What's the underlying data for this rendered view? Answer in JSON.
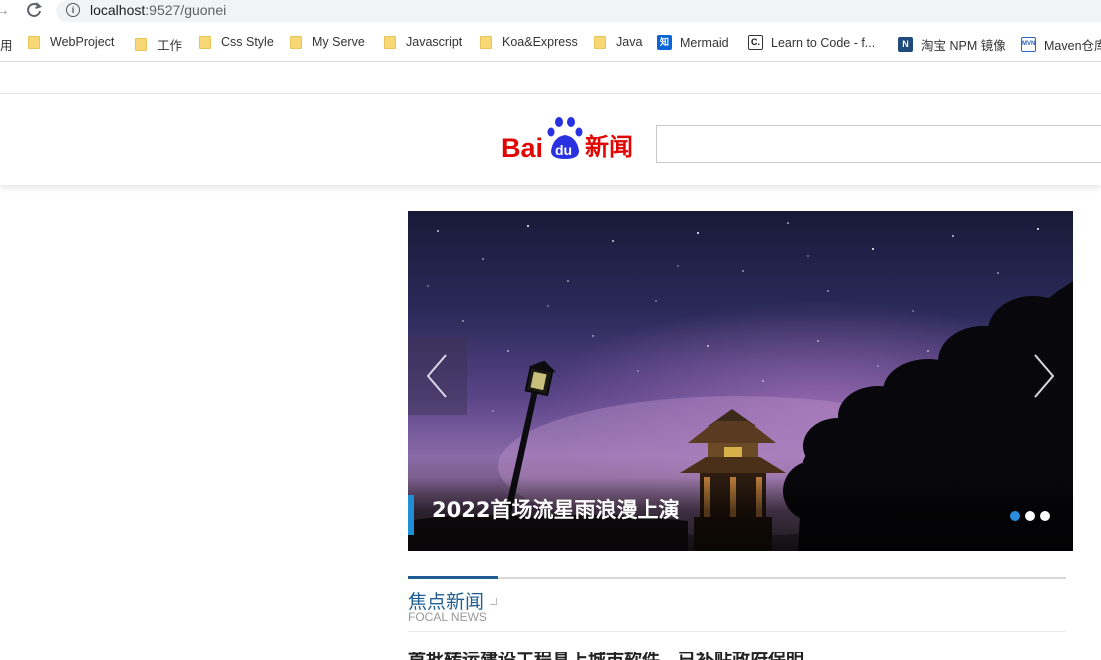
{
  "browser": {
    "url_host": "localhost",
    "url_path": ":9527/guonei",
    "bookmarks": [
      {
        "label": "用",
        "icon": "none"
      },
      {
        "label": "WebProject",
        "icon": "folder-icon"
      },
      {
        "label": "工作",
        "icon": "folder-icon"
      },
      {
        "label": "Css Style",
        "icon": "folder-icon"
      },
      {
        "label": "My Serve",
        "icon": "folder-icon"
      },
      {
        "label": "Javascript",
        "icon": "folder-icon"
      },
      {
        "label": "Koa&Express",
        "icon": "folder-icon"
      },
      {
        "label": "Java",
        "icon": "folder-icon"
      },
      {
        "label": "Mermaid",
        "icon": "zhihu-icon",
        "icon_text": "知",
        "color": "#0a66d6"
      },
      {
        "label": "Learn to Code - f...",
        "icon": "freecodecamp-icon",
        "icon_text": "C.",
        "color": "#ffffff"
      },
      {
        "label": "淘宝 NPM 镜像",
        "icon": "npm-icon",
        "icon_text": "N",
        "color": "#1f4a7a"
      },
      {
        "label": "Maven仓库",
        "icon": "maven-icon",
        "icon_text": "MVN",
        "color": "#2d63b8"
      }
    ]
  },
  "header": {
    "logo_text_bai": "Bai",
    "logo_text_du": "du",
    "logo_text_news": "新闻",
    "search_placeholder": ""
  },
  "carousel": {
    "caption": "2022首场流星雨浪漫上演",
    "slide_count": 3,
    "active_index": 0,
    "colors": {
      "accent": "#1e8fd6",
      "active_dot": "#2a8de0"
    }
  },
  "focal": {
    "title": "焦点新闻",
    "subtitle": "FOCAL NEWS",
    "first_headline": "首批转运建设工程具上城市软件，已补贴政府保明"
  }
}
